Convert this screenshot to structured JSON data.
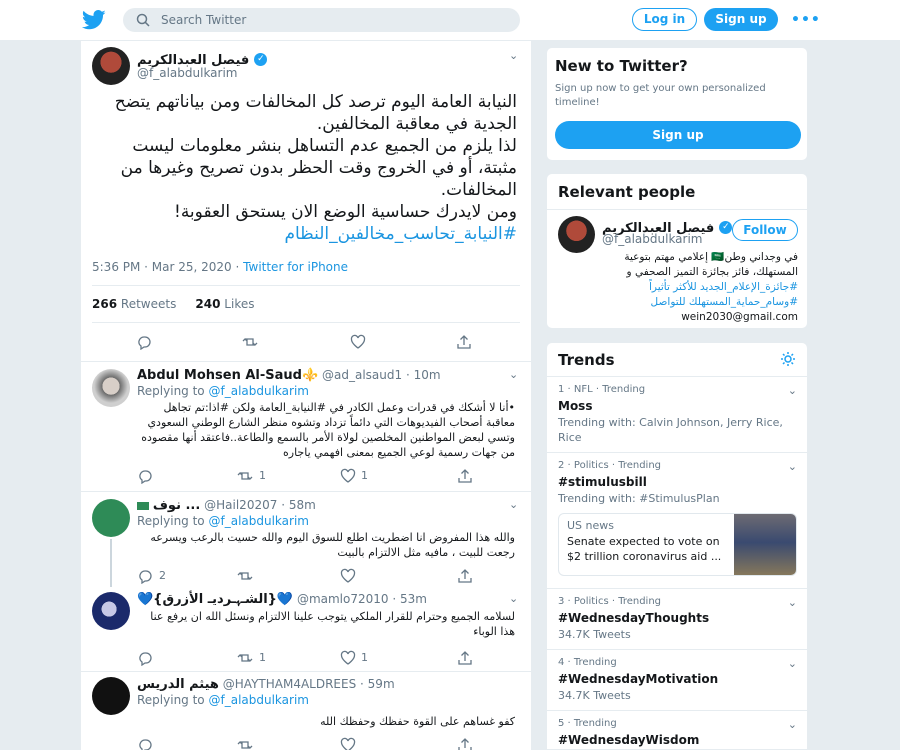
{
  "colors": {
    "accent": "#1da1f2",
    "link": "#1b95e0",
    "muted": "#657786",
    "background": "#e6ecf0"
  },
  "header": {
    "logo_icon": "twitter-bird-icon",
    "search_placeholder": "Search Twitter",
    "login_label": "Log in",
    "signup_label": "Sign up",
    "more_icon": "more-dots-icon"
  },
  "main_tweet": {
    "name": "فيصل العبدالكريم",
    "handle": "@f_alabdulkarim",
    "text_lines": [
      "النيابة العامة اليوم ترصد كل المخالفات ومن بياناتهم يتضح",
      "الجدية في معاقبة المخالفين.",
      "لذا يلزم من الجميع عدم التساهل بنشر معلومات ليست",
      "مثبتة، أو في الخروج وقت الحظر بدون تصريح وغيرها من",
      "المخالفات.",
      "ومن لايدرك حساسية الوضع الان يستحق العقوبة!"
    ],
    "hashtag": "#النيابة_تحاسب_مخالفين_النظام",
    "time": "5:36 PM · Mar 25, 2020",
    "source": "Twitter for iPhone",
    "retweets_count": "266",
    "retweets_label": "Retweets",
    "likes_count": "240",
    "likes_label": "Likes"
  },
  "replies": [
    {
      "name": "Abdul Mohsen Al-Saud⚜️",
      "handle": "@ad_alsaud1",
      "time": "10m",
      "replying_label": "Replying to",
      "replying_to": "@f_alabdulkarim",
      "text": "•أنا لا أشكك في قدرات وعمل الكادر في #النيابة_العامة ولكن #اذا:تم تجاهل معاقبة أصحاب الفيديوهات التي دائماً تزداد وتشوه منظر الشارع الوطني السعودي وتسي لبعض المواطنين المخلصين لولاة الأمر بالسمع والطاعة..فاعتقد أنها مقصوده من جهات رسمية لوعي الجميع بمعنى افهمي ياجاره",
      "retweets": "1",
      "likes": "1"
    },
    {
      "name": "نوف ...",
      "handle": "@Hail20207",
      "time": "58m",
      "replying_label": "Replying to",
      "replying_to": "@f_alabdulkarim",
      "text": "والله هذا المفروض انا اضطريت اطلع للسوق اليوم والله حسيت بالرعب ويسرعه رجعت للبيت ، مافيه مثل الالتزام بالبيت",
      "retweets": "",
      "likes": "",
      "reply_count": "2"
    },
    {
      "name": "💙{الشـﮩـرديـ الأزرق}💙",
      "handle": "@mamlo72010",
      "time": "53m",
      "text": "لسلامه الجميع وحترام للقرار الملكي يتوجب علينا الالتزام ونسئل الله ان يرفع عنا هذا الوباء",
      "retweets": "1",
      "likes": "1"
    },
    {
      "name": "هيثم الدريس",
      "handle": "@HAYTHAM4ALDREES",
      "time": "59m",
      "replying_label": "Replying to",
      "replying_to": "@f_alabdulkarim",
      "text": "كفو غساهم على القوة حفظك وحفظك الله",
      "retweets": "",
      "likes": ""
    }
  ],
  "new_to_twitter": {
    "title": "New to Twitter?",
    "subtitle": "Sign up now to get your own personalized timeline!",
    "button": "Sign up"
  },
  "relevant_people": {
    "title": "Relevant people",
    "name": "فيصل العبدالكريم",
    "handle": "@f_alabdulkarim",
    "follow_label": "Follow",
    "bio_lines": [
      "في وجداني وطن🇸🇦 إعلامي مهتم بتوعية",
      "المستهلك، فائز بجائزة التميز الصحفي و",
      "#جائزة_الإعلام_الجديد للأكثر تأثيراً",
      "#وسام_حماية_المستهلك للتواصل",
      "wein2030@gmail.com"
    ]
  },
  "trends": {
    "title": "Trends",
    "settings_icon": "gear-icon",
    "items": [
      {
        "context": "1 · NFL · Trending",
        "title": "Moss",
        "sub": "Trending with: Calvin Johnson, Jerry Rice, Rice"
      },
      {
        "context": "2 · Politics · Trending",
        "title": "#stimulusbill",
        "sub": "Trending with: #StimulusPlan",
        "card_source": "US news",
        "card_text": "Senate expected to vote on $2 trillion coronavirus aid ..."
      },
      {
        "context": "3 · Politics · Trending",
        "title": "#WednesdayThoughts",
        "sub": "34.7K Tweets"
      },
      {
        "context": "4 · Trending",
        "title": "#WednesdayMotivation",
        "sub": "34.7K Tweets"
      },
      {
        "context": "5 · Trending",
        "title": "#WednesdayWisdom",
        "sub": ""
      }
    ]
  }
}
